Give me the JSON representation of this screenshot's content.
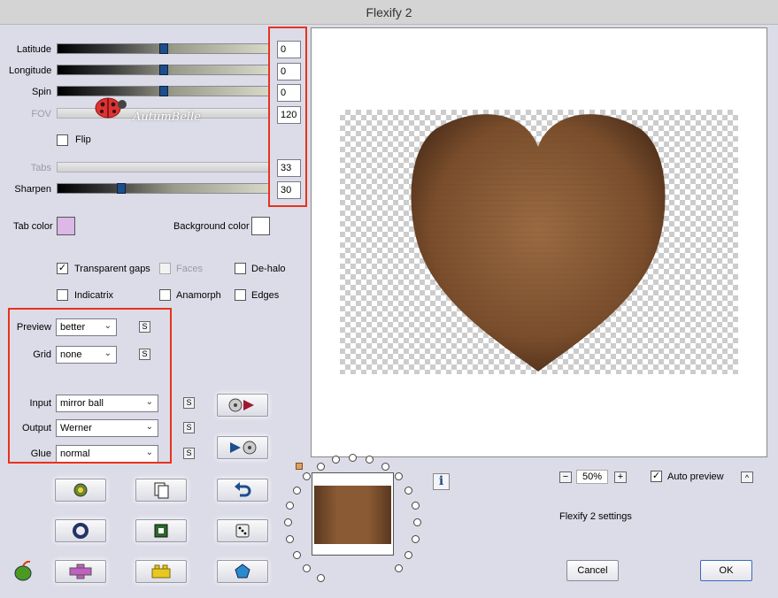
{
  "window": {
    "title": "Flexify 2"
  },
  "params": {
    "latitude": {
      "label": "Latitude",
      "value": "0",
      "level": 0.5
    },
    "longitude": {
      "label": "Longitude",
      "value": "0",
      "level": 0.5
    },
    "spin": {
      "label": "Spin",
      "value": "0",
      "level": 0.5
    },
    "fov": {
      "label": "FOV",
      "value": "120"
    },
    "flip": {
      "label": "Flip",
      "checked": false
    },
    "tabs": {
      "label": "Tabs",
      "value": "33"
    },
    "sharpen": {
      "label": "Sharpen",
      "value": "30",
      "level": 0.3
    }
  },
  "colors": {
    "tab_label": "Tab color",
    "tab_color": "#dcb8e6",
    "bg_label": "Background color",
    "bg_color": "#ffffff",
    "highlight": "#e8321c"
  },
  "options": {
    "transparent_gaps": {
      "label": "Transparent gaps",
      "checked": true
    },
    "faces": {
      "label": "Faces",
      "checked": false,
      "disabled": true
    },
    "dehalo": {
      "label": "De-halo",
      "checked": false
    },
    "indicatrix": {
      "label": "Indicatrix",
      "checked": false
    },
    "anamorph": {
      "label": "Anamorph",
      "checked": false
    },
    "edges": {
      "label": "Edges",
      "checked": false
    }
  },
  "selects": {
    "preview": {
      "label": "Preview",
      "value": "better"
    },
    "grid": {
      "label": "Grid",
      "value": "none"
    },
    "input": {
      "label": "Input",
      "value": "mirror ball"
    },
    "output": {
      "label": "Output",
      "value": "Werner"
    },
    "glue": {
      "label": "Glue",
      "value": "normal"
    }
  },
  "s_label": "S",
  "watermark": "AutumBelle",
  "zoom": {
    "value": "50%",
    "minus": "−",
    "plus": "+"
  },
  "auto_preview": {
    "label": "Auto preview",
    "checked": true
  },
  "up_label": "^",
  "info_label": "i",
  "settings_label": "Flexify 2 settings",
  "buttons": {
    "cancel": "Cancel",
    "ok": "OK"
  }
}
